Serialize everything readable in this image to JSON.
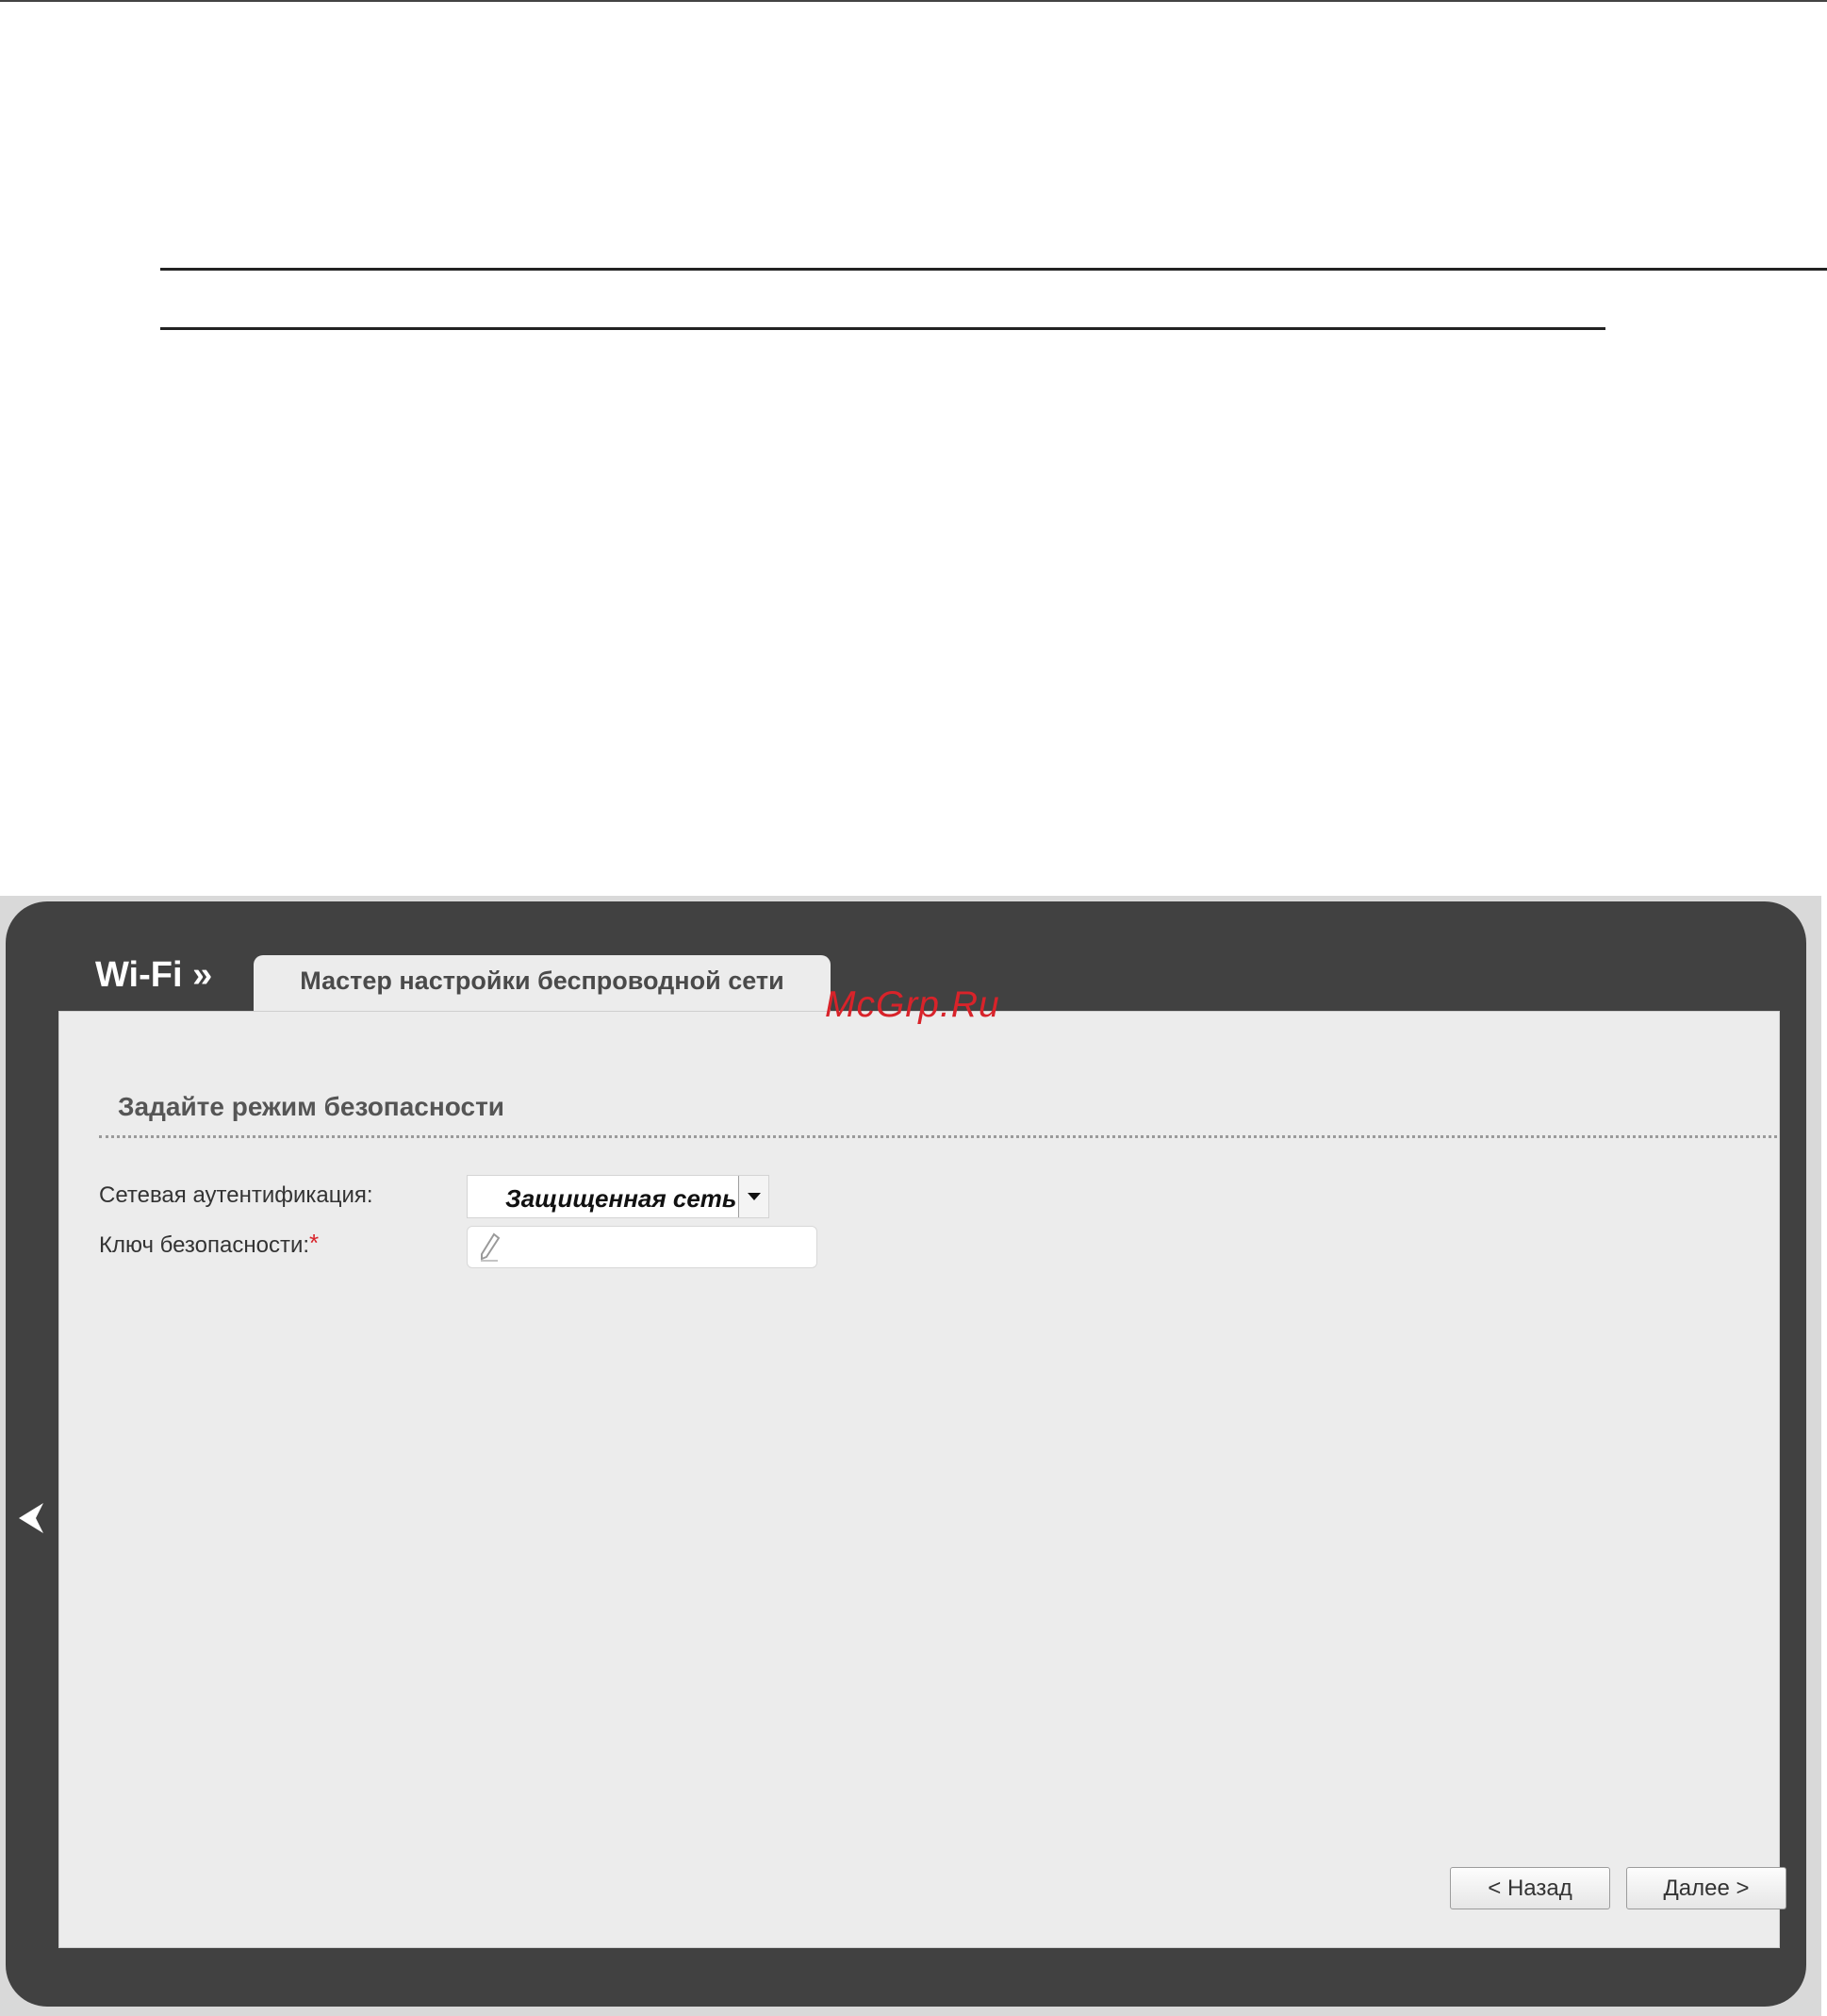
{
  "header": {
    "section": "Wi-Fi »",
    "tab_label": "Мастер настройки беспроводной сети"
  },
  "watermark": "McGrp.Ru",
  "form": {
    "title": "Задайте режим безопасности",
    "auth_label": "Сетевая аутентификация:",
    "auth_value": "Защищенная сеть",
    "key_label": "Ключ безопасности:",
    "key_required_mark": "*",
    "key_value": ""
  },
  "buttons": {
    "back": "< Назад",
    "next": "Далее >"
  },
  "icons": {
    "collapse": "chevron-left-icon",
    "field_edit": "pencil-icon",
    "dropdown": "caret-down-icon"
  },
  "colors": {
    "frame": "#414141",
    "panel": "#ececec",
    "accent_red": "#d8232a"
  }
}
